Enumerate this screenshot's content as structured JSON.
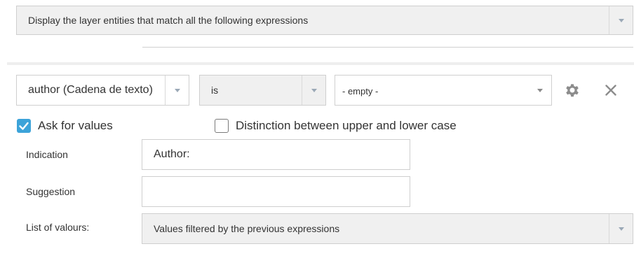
{
  "filter": {
    "match_mode": "Display the layer entities that match all the following expressions"
  },
  "expression": {
    "field": "author (Cadena de texto)",
    "operator": "is",
    "value_placeholder": "- empty -",
    "settings_icon": "gear-icon",
    "remove_icon": "close-icon"
  },
  "options": {
    "ask_for_values": {
      "label": "Ask for values",
      "checked": true
    },
    "case_sensitive": {
      "label": "Distinction between upper and lower case",
      "checked": false
    }
  },
  "form": {
    "indication_label": "Indication",
    "indication_value": "Author:",
    "suggestion_label": "Suggestion",
    "suggestion_value": "",
    "list_label": "List of valours:",
    "list_value": "Values filtered by the previous expressions"
  },
  "colors": {
    "checkbox_accent": "#3ca3d9",
    "caret": "#9aa8b6",
    "icon_gray": "#8c8c8c"
  }
}
